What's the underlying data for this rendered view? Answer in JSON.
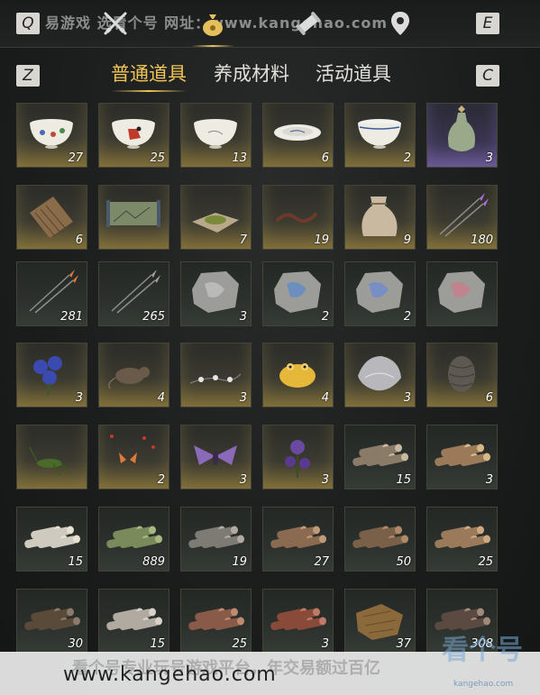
{
  "topbar": {
    "key_left": "Q",
    "key_right": "E",
    "watermark": "易游戏 选看个号 网址：www.kangehao.com",
    "icons": [
      "crossed-swords-icon",
      "money-bag-icon",
      "scroll-icon",
      "map-pin-icon"
    ],
    "active_icon": "money-bag-icon"
  },
  "tabs": {
    "key_left": "Z",
    "key_right": "C",
    "items": [
      {
        "label": "普通道具",
        "active": true
      },
      {
        "label": "养成材料",
        "active": false
      },
      {
        "label": "活动道具",
        "active": false
      }
    ]
  },
  "inventory": [
    {
      "name": "porcelain-bowl-flowers-icon",
      "qty": "27"
    },
    {
      "name": "porcelain-bowl-rooster-icon",
      "qty": "25"
    },
    {
      "name": "white-bowl-icon",
      "qty": "13"
    },
    {
      "name": "plate-icon",
      "qty": "6"
    },
    {
      "name": "blue-rim-bowl-icon",
      "qty": "2"
    },
    {
      "name": "celadon-vase-icon",
      "qty": "3",
      "rare": true
    },
    {
      "name": "wooden-slips-icon",
      "qty": "6"
    },
    {
      "name": "scroll-painting-icon",
      "qty": ""
    },
    {
      "name": "tea-powder-icon",
      "qty": "7"
    },
    {
      "name": "earthworm-icon",
      "qty": "19"
    },
    {
      "name": "cloth-sack-icon",
      "qty": "9"
    },
    {
      "name": "purple-arrows-icon",
      "qty": "180"
    },
    {
      "name": "fire-arrows-icon",
      "qty": "281",
      "plain": true
    },
    {
      "name": "iron-arrows-icon",
      "qty": "265",
      "plain": true
    },
    {
      "name": "stone-rubbing-deer-icon",
      "qty": "3",
      "plain": true
    },
    {
      "name": "stone-rubbing-bird-icon",
      "qty": "2",
      "plain": true
    },
    {
      "name": "stone-rubbing-dragon-icon",
      "qty": "2",
      "plain": true
    },
    {
      "name": "stone-rubbing-fish-icon",
      "qty": "",
      "plain": true
    },
    {
      "name": "blue-flower-icon",
      "qty": "3"
    },
    {
      "name": "rat-icon",
      "qty": "4"
    },
    {
      "name": "white-blossom-branch-icon",
      "qty": "3"
    },
    {
      "name": "golden-toad-icon",
      "qty": "4"
    },
    {
      "name": "oyster-shell-icon",
      "qty": "3"
    },
    {
      "name": "pine-cone-icon",
      "qty": "6"
    },
    {
      "name": "grasshopper-icon",
      "qty": ""
    },
    {
      "name": "butterflies-icon",
      "qty": "2"
    },
    {
      "name": "purple-moth-icon",
      "qty": "3"
    },
    {
      "name": "purple-flower-icon",
      "qty": "3"
    },
    {
      "name": "logs-small-icon",
      "qty": "15",
      "plain": true
    },
    {
      "name": "logs-bundle-icon",
      "qty": "3",
      "plain": true
    },
    {
      "name": "birch-logs-icon",
      "qty": "15",
      "plain": true
    },
    {
      "name": "bamboo-logs-icon",
      "qty": "889",
      "plain": true
    },
    {
      "name": "grey-logs-icon",
      "qty": "19",
      "plain": true
    },
    {
      "name": "brown-logs-icon",
      "qty": "27",
      "plain": true
    },
    {
      "name": "rough-logs-icon",
      "qty": "50",
      "plain": true
    },
    {
      "name": "pine-logs-icon",
      "qty": "25",
      "plain": true
    },
    {
      "name": "dark-logs-icon",
      "qty": "30",
      "plain": true
    },
    {
      "name": "pale-logs-icon",
      "qty": "15",
      "plain": true
    },
    {
      "name": "red-logs-icon",
      "qty": "25",
      "plain": true
    },
    {
      "name": "reddish-logs-icon",
      "qty": "3",
      "plain": true
    },
    {
      "name": "brown-fur-icon",
      "qty": "37",
      "plain": true
    },
    {
      "name": "charred-logs-icon",
      "qty": "308",
      "plain": true
    }
  ],
  "footer": {
    "url": "www.kangehao.com",
    "faded": "看个号专业玩号游戏平台，年交易额过百亿",
    "logo": "看个号",
    "logo_sub": "kangehao.com"
  },
  "colors": {
    "active_gold": "#f0c456",
    "cell_bottom": "#6b5e34",
    "rare_bottom": "#5a4d7a"
  }
}
